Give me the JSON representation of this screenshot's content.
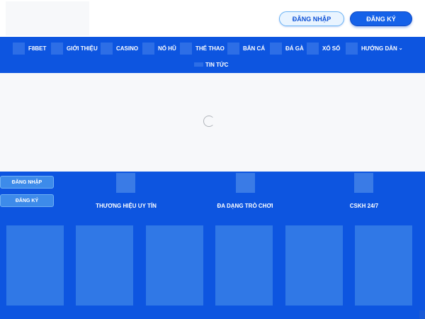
{
  "header": {
    "login_label": "ĐĂNG NHẬP",
    "register_label": "ĐĂNG KÝ"
  },
  "nav": {
    "items": [
      {
        "label": "F8BET"
      },
      {
        "label": "GIỚI THIỆU"
      },
      {
        "label": "CASINO"
      },
      {
        "label": "NỔ HŨ"
      },
      {
        "label": "THỂ THAO"
      },
      {
        "label": "BẮN CÁ"
      },
      {
        "label": "ĐÁ GÀ"
      },
      {
        "label": "XỔ SỐ"
      },
      {
        "label": "HƯỚNG DẪN"
      },
      {
        "label": "TIN TỨC"
      }
    ]
  },
  "section": {
    "login_label": "ĐĂNG NHẬP",
    "register_label": "ĐĂNG KÝ",
    "features": [
      {
        "label": "THƯƠNG HIỆU UY TÍN"
      },
      {
        "label": "ĐA DẠNG TRÒ CHƠI"
      },
      {
        "label": "CSKH 24/7"
      }
    ]
  },
  "colors": {
    "primary_blue": "#0d55e0",
    "loading_bg": "#f7f8fa"
  }
}
